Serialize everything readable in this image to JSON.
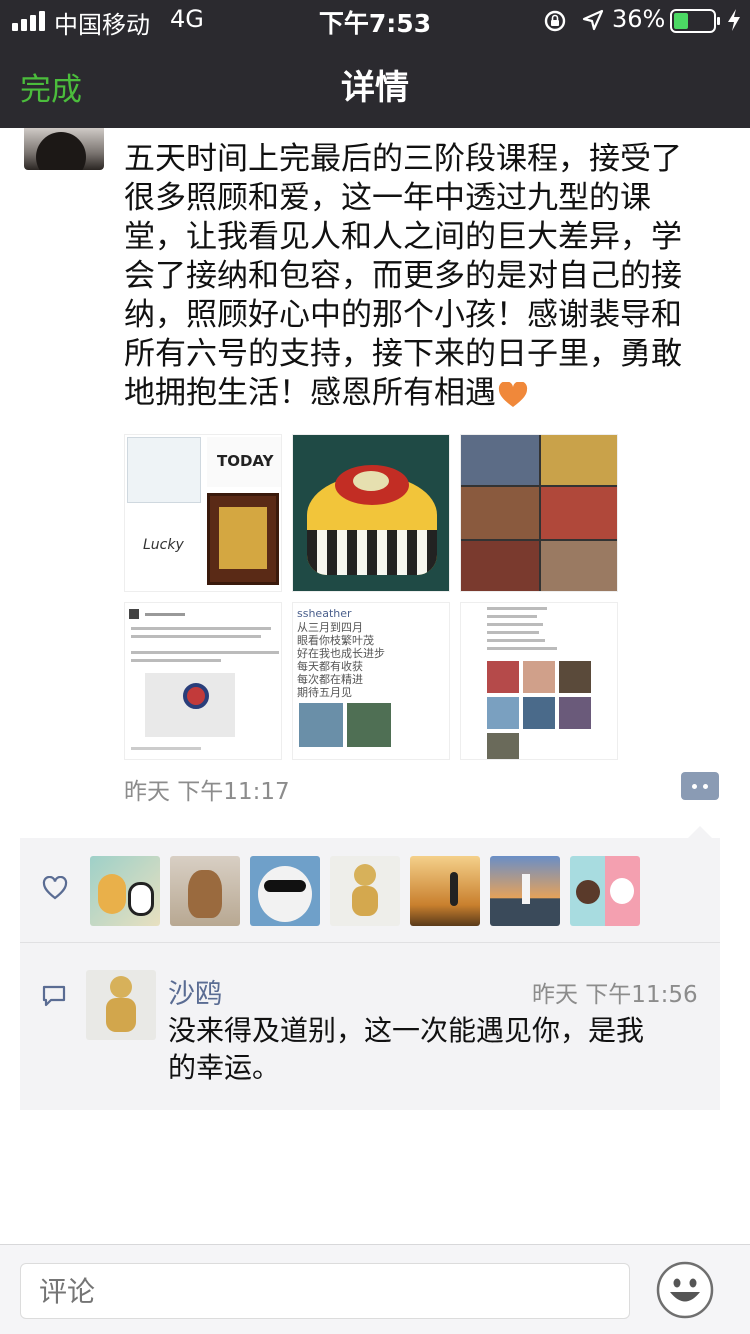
{
  "status_bar": {
    "carrier": "中国移动",
    "network": "4G",
    "time": "下午7:53",
    "battery": "36%",
    "battery_level": 0.36,
    "icons": [
      "signal-icon",
      "lock-rotation-icon",
      "location-icon",
      "battery-icon",
      "charging-icon"
    ]
  },
  "nav": {
    "done_label": "完成",
    "title": "详情"
  },
  "post": {
    "lines": [
      "五天时间上完最后的三阶段课程，接受了",
      "很多照顾和爱，这一年中透过九型的课",
      "堂，让我看见人和人之间的巨大差异，学",
      "会了接纳和包容，而更多的是对自己的接",
      "纳，照顾好心中的那个小孩！感谢裴导和",
      "所有六号的支持，接下来的日子里，勇敢",
      "地拥抱生活！感恩所有相遇"
    ],
    "emoji": "orange-heart-emoji",
    "photo_text": {
      "today": "TODAY",
      "lucky": "Lucky",
      "user": "ssheather",
      "poem": [
        "从三月到四月",
        "眼看你枝繁叶茂",
        "好在我也成长进步",
        "每天都有收获",
        "每次都在精进",
        "期待五月见"
      ]
    },
    "time": "昨天 下午11:17"
  },
  "likes": {
    "count": 7,
    "avatars": [
      "cartoon-panda-avatar",
      "cat-avatar",
      "sunglasses-cat-avatar",
      "figurine-avatar",
      "sunset-runner-avatar",
      "lighthouse-avatar",
      "cute-bears-avatar"
    ]
  },
  "comment": {
    "name": "沙鸥",
    "time": "昨天 下午11:56",
    "lines": [
      "没来得及道别，这一次能遇见你，是我",
      "的幸运。"
    ]
  },
  "input": {
    "placeholder": "评论"
  },
  "colors": {
    "nav_bg": "#2b2a2f",
    "done_green": "#4bbd3c",
    "name_blue": "#5a6c93",
    "time_gray": "#8c8c8c",
    "box_bg": "#f3f3f5"
  }
}
